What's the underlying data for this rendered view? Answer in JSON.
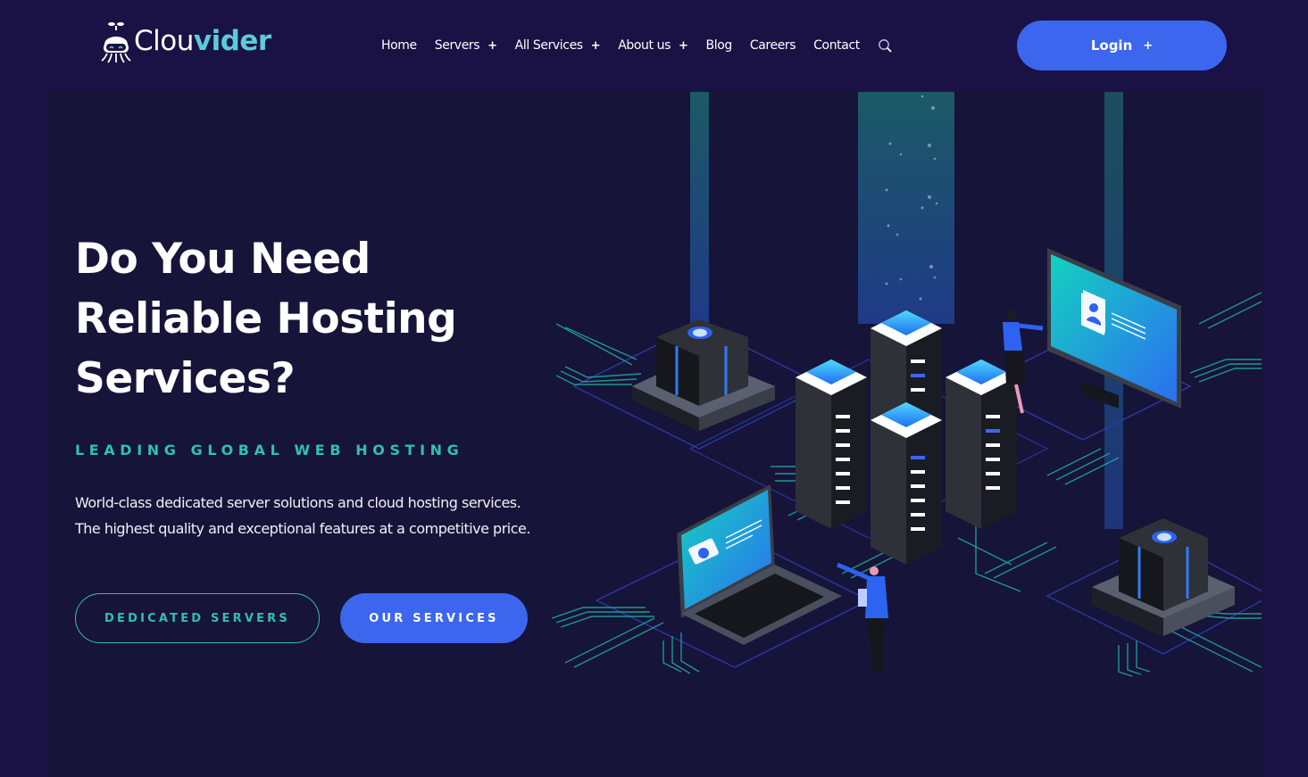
{
  "brand": {
    "name_part1": "Clou",
    "name_part2": "vider",
    "logo_icon": "octopus-robot-icon",
    "accent_color": "#5ccbd9"
  },
  "nav": {
    "items": [
      {
        "label": "Home",
        "has_submenu": false
      },
      {
        "label": "Servers",
        "has_submenu": true
      },
      {
        "label": "All Services",
        "has_submenu": true
      },
      {
        "label": "About us",
        "has_submenu": true
      },
      {
        "label": "Blog",
        "has_submenu": false
      },
      {
        "label": "Careers",
        "has_submenu": false
      },
      {
        "label": "Contact",
        "has_submenu": false
      }
    ],
    "submenu_marker": "+",
    "search_icon": "search-icon",
    "login_label": "Login",
    "login_marker": "+"
  },
  "hero": {
    "title_lines": [
      "Do You Need",
      "Reliable Hosting",
      "Services?"
    ],
    "tagline": "LEADING GLOBAL WEB HOSTING",
    "description_lines": [
      "World-class dedicated server solutions and cloud hosting services.",
      "The highest quality and exceptional features at a competitive price."
    ],
    "primary_button": "OUR SERVICES",
    "secondary_button": "DEDICATED SERVERS",
    "illustration": "isometric-data-center-illustration"
  },
  "colors": {
    "page_bg": "#1a1244",
    "hero_bg": "#161438",
    "primary_blue": "#3d66ee",
    "teal": "#2fc0b5"
  }
}
